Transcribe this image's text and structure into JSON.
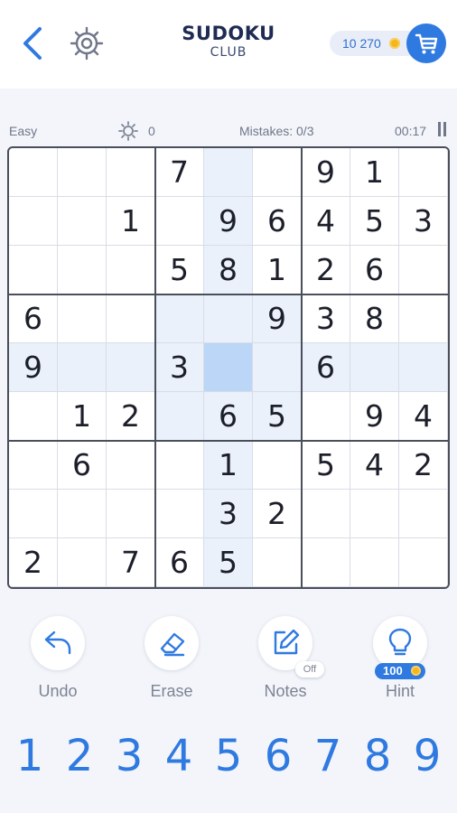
{
  "header": {
    "title": "SUDOKU",
    "subtitle": "CLUB",
    "coins": "10 270",
    "icons": {
      "back": "chevron-left-icon",
      "settings": "gear-icon",
      "cart": "cart-icon",
      "coin": "coin-icon"
    }
  },
  "status": {
    "difficulty": "Easy",
    "score": "0",
    "mistakes": "Mistakes: 0/3",
    "timer": "00:17"
  },
  "board": {
    "rows": [
      [
        "",
        "",
        "",
        "7",
        "",
        "",
        "9",
        "1",
        ""
      ],
      [
        "",
        "",
        "1",
        "",
        "9",
        "6",
        "4",
        "5",
        "3"
      ],
      [
        "",
        "",
        "",
        "5",
        "8",
        "1",
        "2",
        "6",
        ""
      ],
      [
        "6",
        "",
        "",
        "",
        "",
        "9",
        "3",
        "8",
        ""
      ],
      [
        "9",
        "",
        "",
        "3",
        "",
        "",
        "6",
        "",
        ""
      ],
      [
        "",
        "1",
        "2",
        "",
        "6",
        "5",
        "",
        "9",
        "4"
      ],
      [
        "",
        "6",
        "",
        "",
        "1",
        "",
        "5",
        "4",
        "2"
      ],
      [
        "",
        "",
        "",
        "",
        "3",
        "2",
        "",
        "",
        ""
      ],
      [
        "2",
        "",
        "7",
        "6",
        "5",
        "",
        "",
        "",
        ""
      ]
    ],
    "selected_cell": {
      "row": 4,
      "col": 4
    }
  },
  "tools": {
    "undo": "Undo",
    "erase": "Erase",
    "notes": "Notes",
    "notes_state": "Off",
    "hint": "Hint",
    "hint_cost": "100"
  },
  "numpad": [
    "1",
    "2",
    "3",
    "4",
    "5",
    "6",
    "7",
    "8",
    "9"
  ],
  "colors": {
    "accent": "#2f7ae0",
    "selected": "#bcd6f8",
    "highlight": "#eaf1fb",
    "text": "#1c1f2a",
    "muted": "#7d8494"
  }
}
